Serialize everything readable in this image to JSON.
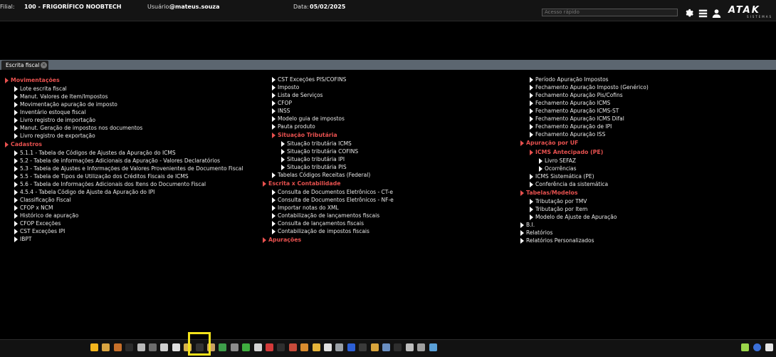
{
  "header": {
    "filial_label": "Filial:",
    "filial_value": "100 - FRIGORÍFICO NOOBTECH",
    "usuario_label": "Usuário:",
    "usuario_value": "@mateus.souza",
    "data_label": "Data:",
    "data_value": "05/02/2025",
    "quick_access_placeholder": "Acesso rápido",
    "logo_text": "ATAK",
    "logo_subtext": "SISTEMAS"
  },
  "tabs": [
    {
      "label": "Escrita fiscal"
    }
  ],
  "columns": [
    [
      {
        "label": "Movimentações",
        "section": true,
        "indent": 0
      },
      {
        "label": "Lote escrita fiscal",
        "indent": 1
      },
      {
        "label": "Manut. Valores de Item/Impostos",
        "indent": 1
      },
      {
        "label": "Movimentação apuração de imposto",
        "indent": 1
      },
      {
        "label": "Inventário estoque fiscal",
        "indent": 1
      },
      {
        "label": "Livro registro de importação",
        "indent": 1
      },
      {
        "label": "Manut. Geração de impostos nos documentos",
        "indent": 1
      },
      {
        "label": "Livro registro de exportação",
        "indent": 1
      },
      {
        "label": "Cadastros",
        "section": true,
        "indent": 0
      },
      {
        "label": "5.1.1 - Tabela de Códigos de Ajustes da Apuração do ICMS",
        "indent": 1
      },
      {
        "label": "5.2 - Tabela de informações Adicionais da Apuração - Valores Declaratórios",
        "indent": 1
      },
      {
        "label": "5.3 - Tabela de Ajustes e Informações de Valores Provenientes de Documento Fiscal",
        "indent": 1
      },
      {
        "label": "5.5 - Tabela de Tipos de Utilização dos Créditos Fiscais de ICMS",
        "indent": 1
      },
      {
        "label": "5.6 - Tabela de Informações Adicionais dos Itens do Documento Fiscal",
        "indent": 1
      },
      {
        "label": "4.5.4 - Tabela Código de Ajuste da Apuração do IPI",
        "indent": 1
      },
      {
        "label": "Classificação Fiscal",
        "indent": 1
      },
      {
        "label": "CFOP x NCM",
        "indent": 1
      },
      {
        "label": "Histórico de apuração",
        "indent": 1
      },
      {
        "label": "CFOP Exceções",
        "indent": 1
      },
      {
        "label": "CST Exceções IPI",
        "indent": 1
      },
      {
        "label": "IBPT",
        "indent": 1
      }
    ],
    [
      {
        "label": "CST Exceções PIS/COFINS",
        "indent": 1
      },
      {
        "label": "Imposto",
        "indent": 1
      },
      {
        "label": "Lista de Serviços",
        "indent": 1
      },
      {
        "label": "CFOP",
        "indent": 1
      },
      {
        "label": "INSS",
        "indent": 1
      },
      {
        "label": "Modelo guia de impostos",
        "indent": 1
      },
      {
        "label": "Pauta produto",
        "indent": 1
      },
      {
        "label": "Situação Tributária",
        "section": true,
        "indent": 1
      },
      {
        "label": "Situação tributária ICMS",
        "indent": 2
      },
      {
        "label": "Situação tributária COFINS",
        "indent": 2
      },
      {
        "label": "Situação tributária IPI",
        "indent": 2
      },
      {
        "label": "Situação tributária PIS",
        "indent": 2
      },
      {
        "label": "Tabelas Códigos Receitas (Federal)",
        "indent": 1
      },
      {
        "label": "Escrita x Contabilidade",
        "section": true,
        "indent": 0
      },
      {
        "label": "Consulta de Documentos Eletrônicos - CT-e",
        "indent": 1
      },
      {
        "label": "Consulta de Documentos Eletrônicos - NF-e",
        "indent": 1
      },
      {
        "label": "Importar notas do XML",
        "indent": 1
      },
      {
        "label": "Contabilização de lançamentos fiscais",
        "indent": 1
      },
      {
        "label": "Consulta de lançamentos fiscais",
        "indent": 1
      },
      {
        "label": "Contabilização de impostos fiscais",
        "indent": 1
      },
      {
        "label": "Apurações",
        "section": true,
        "indent": 0
      }
    ],
    [
      {
        "label": "Período Apuração Impostos",
        "indent": 1
      },
      {
        "label": "Fechamento Apuração Imposto (Genérico)",
        "indent": 1
      },
      {
        "label": "Fechamento Apuração Pis/Cofins",
        "indent": 1
      },
      {
        "label": "Fechamento Apuração ICMS",
        "indent": 1
      },
      {
        "label": "Fechamento Apuração ICMS-ST",
        "indent": 1
      },
      {
        "label": "Fechamento Apuração ICMS Difal",
        "indent": 1
      },
      {
        "label": "Fechamento Apuração de IPI",
        "indent": 1
      },
      {
        "label": "Fechamento Apuração ISS",
        "indent": 1
      },
      {
        "label": "Apuração por UF",
        "section": true,
        "indent": 0
      },
      {
        "label": "ICMS Antecipado (PE)",
        "section": true,
        "indent": 1
      },
      {
        "label": "Livro SEFAZ",
        "indent": 2
      },
      {
        "label": "Ocorrências",
        "indent": 2
      },
      {
        "label": "ICMS Sistemática (PE)",
        "indent": 1
      },
      {
        "label": "Conferência da sistemática",
        "indent": 1
      },
      {
        "label": "Tabelas/Modelos",
        "section": true,
        "indent": 0
      },
      {
        "label": "Tributação por TMV",
        "indent": 1
      },
      {
        "label": "Tributação por Item",
        "indent": 1
      },
      {
        "label": "Modelo de Ajuste de Apuração",
        "indent": 1
      },
      {
        "label": "B.I.",
        "indent": 0
      },
      {
        "label": "Relatórios",
        "indent": 0
      },
      {
        "label": "Relatórios Personalizados",
        "indent": 0
      }
    ]
  ],
  "toolbar": {
    "buttons": [
      {
        "name": "favorites-star-icon",
        "color": "#f2b51d"
      },
      {
        "name": "people-icon",
        "color": "#d9a441"
      },
      {
        "name": "briefcase-icon",
        "color": "#c7702a"
      },
      {
        "name": "dark-panel-icon",
        "color": "#2b2b2b"
      },
      {
        "name": "document-grid-icon",
        "color": "#b8b8b8"
      },
      {
        "name": "printer-icon",
        "color": "#6d6d6d"
      },
      {
        "name": "scale-icon",
        "color": "#d0d0d0"
      },
      {
        "name": "pill-icon",
        "color": "#e0e0e0"
      },
      {
        "name": "folder-icon",
        "color": "#d8b24a"
      },
      {
        "name": "monitor-icon",
        "color": "#333333"
      },
      {
        "name": "receipt-icon",
        "color": "#c9a063"
      },
      {
        "name": "globe-icon",
        "color": "#3e9e4a"
      },
      {
        "name": "battery-icon",
        "color": "#8c8c8c"
      },
      {
        "name": "dollar-icon",
        "color": "#3fae3f"
      },
      {
        "name": "cash-register-icon",
        "color": "#d4d4d4"
      },
      {
        "name": "truck-icon",
        "color": "#d43a3a"
      },
      {
        "name": "terminal-icon",
        "color": "#2f2f2f"
      },
      {
        "name": "bottle-icon",
        "color": "#c84b3b"
      },
      {
        "name": "card-icon",
        "color": "#d98c2f"
      },
      {
        "name": "chart-icon",
        "color": "#e5b43a"
      },
      {
        "name": "notepad-icon",
        "color": "#e0e0e0"
      },
      {
        "name": "calculator-icon",
        "color": "#9aa0a6"
      },
      {
        "name": "cube-icon",
        "color": "#2c5fd6"
      },
      {
        "name": "tools-icon",
        "color": "#3a3a3a"
      },
      {
        "name": "boxes-icon",
        "color": "#d8a43c"
      },
      {
        "name": "users-card-icon",
        "color": "#6a8fc2"
      },
      {
        "name": "list-dark-icon",
        "color": "#2e2e2e"
      },
      {
        "name": "network-icon",
        "color": "#bdbdbd"
      },
      {
        "name": "headset-icon",
        "color": "#9e9e9e"
      },
      {
        "name": "group-icon",
        "color": "#5aa0d8"
      }
    ],
    "right": [
      {
        "name": "favorite-add-icon",
        "color": "#9bd64a"
      },
      {
        "name": "help-icon",
        "color": "#3b6fd8"
      },
      {
        "name": "exit-icon",
        "color": "#e6e6e6"
      }
    ]
  }
}
